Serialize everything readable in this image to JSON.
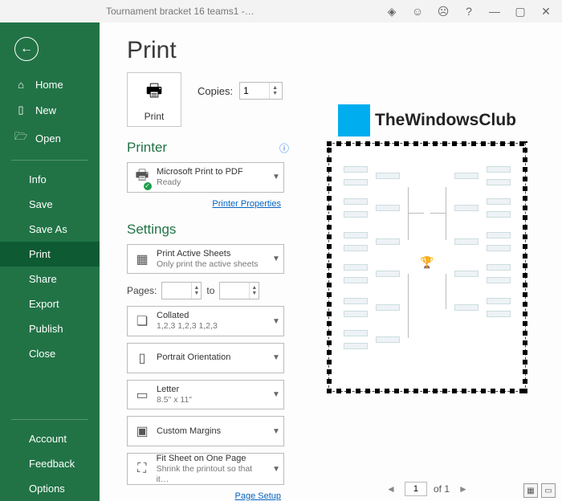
{
  "titlebar": {
    "title": "Tournament bracket 16 teams1  -…"
  },
  "sidebar": {
    "home": "Home",
    "new": "New",
    "open": "Open",
    "info": "Info",
    "save": "Save",
    "saveas": "Save As",
    "print": "Print",
    "share": "Share",
    "export": "Export",
    "publish": "Publish",
    "close": "Close",
    "account": "Account",
    "feedback": "Feedback",
    "options": "Options"
  },
  "page": {
    "heading": "Print",
    "print_btn": "Print",
    "copies_label": "Copies:",
    "copies_value": "1",
    "printer_heading": "Printer",
    "printer_name": "Microsoft Print to PDF",
    "printer_status": "Ready",
    "printer_props": "Printer Properties",
    "settings_heading": "Settings",
    "print_what_l1": "Print Active Sheets",
    "print_what_l2": "Only print the active sheets",
    "pages_label": "Pages:",
    "pages_to": "to",
    "collate_l1": "Collated",
    "collate_l2": "1,2,3    1,2,3    1,2,3",
    "orient": "Portrait Orientation",
    "paper_l1": "Letter",
    "paper_l2": "8.5\" x 11\"",
    "margins": "Custom Margins",
    "scale_l1": "Fit Sheet on One Page",
    "scale_l2": "Shrink the printout so that it…",
    "page_setup": "Page Setup"
  },
  "watermark": "TheWindowsClub",
  "pager": {
    "page": "1",
    "of": "of 1"
  }
}
